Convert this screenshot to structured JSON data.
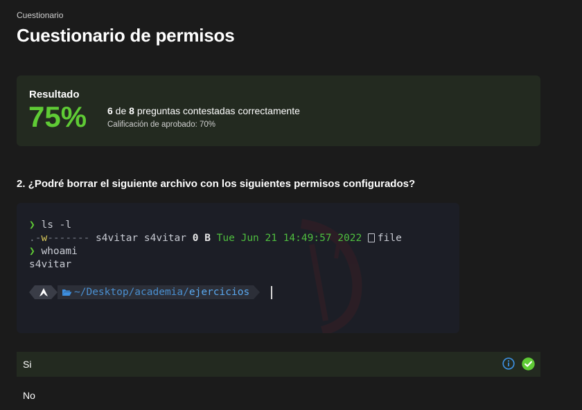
{
  "breadcrumb": "Cuestionario",
  "title": "Cuestionario de permisos",
  "result": {
    "label": "Resultado",
    "percent": "75%",
    "correct": "6",
    "of_word": " de ",
    "total": "8",
    "summary_tail": " preguntas contestadas correctamente",
    "pass_grade": "Calificación de aprobado: 70%",
    "accent_color": "#5fcb35"
  },
  "question": "2. ¿Podré borrar el siguiente archivo con los siguientes permisos configurados?",
  "terminal": {
    "prompt_symbol": "❯",
    "cmd1": "ls -l",
    "perm_prefix": ".-",
    "perm_w": "w",
    "perm_rest": "-------",
    "owner": "s4vitar",
    "group": "s4vitar",
    "size_num": "0",
    "size_unit": "B",
    "date": "Tue Jun 21 14:49:57 2022",
    "file_icon": "file-icon",
    "filename": "file",
    "cmd2": "whoami",
    "output2": "s4vitar",
    "path_home": "~/Desktop/academia/",
    "path_dir": "ejercicios"
  },
  "answers": [
    {
      "label": "Si",
      "state": "correct-selected"
    },
    {
      "label": "No",
      "state": "unselected"
    }
  ],
  "icons": {
    "info": "info-icon",
    "check": "check-circle-icon",
    "info_color": "#3d8fe0",
    "check_color": "#5fcb35"
  }
}
